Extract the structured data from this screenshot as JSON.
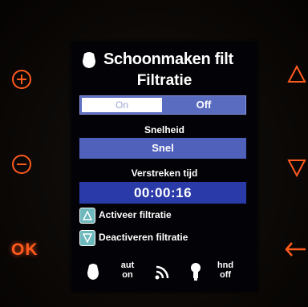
{
  "hardware_buttons": {
    "ok_label": "OK"
  },
  "screen": {
    "title": "Schoonmaken filt",
    "subtitle": "Filtratie",
    "toggle": {
      "on_label": "On",
      "off_label": "Off",
      "selected": "Off"
    },
    "speed": {
      "label": "Snelheid",
      "value": "Snel"
    },
    "elapsed": {
      "label": "Verstreken tijd",
      "value": "00:00:16"
    },
    "actions": [
      {
        "key": "up",
        "label": "Activeer filtratie"
      },
      {
        "key": "down",
        "label": "Deactiveren filtratie"
      }
    ],
    "footer": {
      "auto_line1": "aut",
      "auto_line2": "on",
      "manual_line1": "hnd",
      "manual_line2": "off"
    }
  },
  "colors": {
    "hardware_glow": "#ff5a1e",
    "toggle_bg": "#5a6cc0",
    "speed_bg": "#5061bb",
    "time_bg": "#2a3aa8",
    "action_key_bg": "#6cb8bd"
  },
  "icons": {
    "title": "pump-icon",
    "footer": [
      "pump-icon",
      "wifi-signal-icon",
      "bulb-icon"
    ]
  }
}
